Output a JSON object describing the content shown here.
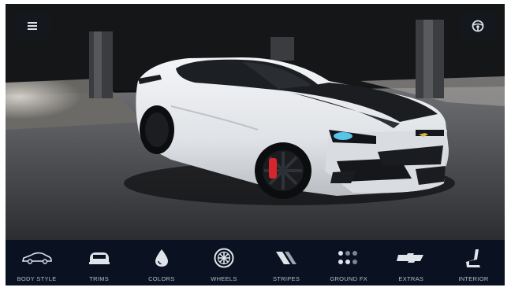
{
  "header": {
    "menu_icon": "hamburger-menu-icon",
    "steering_icon": "steering-wheel-icon"
  },
  "scene": {
    "subject": "white sports coupe with black hood stripes in a garage",
    "car_color": "#e9ebee",
    "stripe_color": "#1b1d21"
  },
  "nav": {
    "items": [
      {
        "label": "BODY STYLE",
        "icon": "body-style-icon"
      },
      {
        "label": "TRIMS",
        "icon": "trims-icon"
      },
      {
        "label": "COLORS",
        "icon": "colors-drop-icon"
      },
      {
        "label": "WHEELS",
        "icon": "wheels-icon"
      },
      {
        "label": "STRIPES",
        "icon": "stripes-icon"
      },
      {
        "label": "GROUND FX",
        "icon": "ground-fx-icon"
      },
      {
        "label": "EXTRAS",
        "icon": "extras-bowtie-icon"
      },
      {
        "label": "INTERIOR",
        "icon": "interior-seat-icon"
      }
    ]
  },
  "colors": {
    "bar_background": "#0a1222",
    "label_color": "#b5bcc7",
    "icon_color": "#dfe4ea"
  }
}
